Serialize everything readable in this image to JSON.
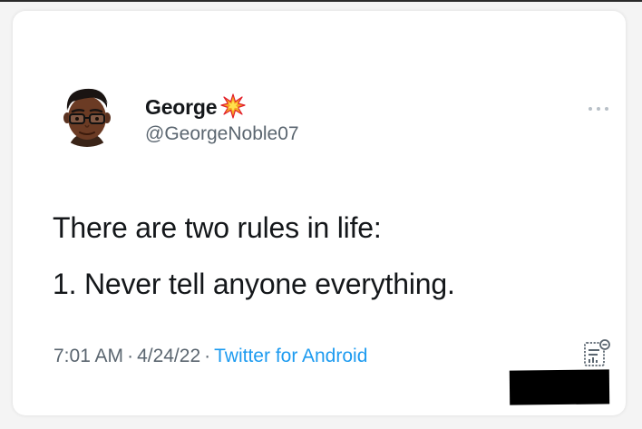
{
  "author": {
    "name": "George",
    "handle": "@GeorgeNoble07",
    "name_emoji": "collision-burst-icon"
  },
  "tweet": {
    "lines": [
      "There are two rules in life:",
      "1. Never tell anyone everything."
    ]
  },
  "meta": {
    "time": "7:01 AM",
    "separator": "·",
    "date": "4/24/22",
    "source": "Twitter for Android"
  },
  "icons": {
    "more": "more-options-icon",
    "analytics": "tweet-analytics-icon"
  },
  "colors": {
    "link": "#1d9bf0",
    "text": "#14171a",
    "muted": "#5b6670",
    "redaction": "#000000"
  }
}
